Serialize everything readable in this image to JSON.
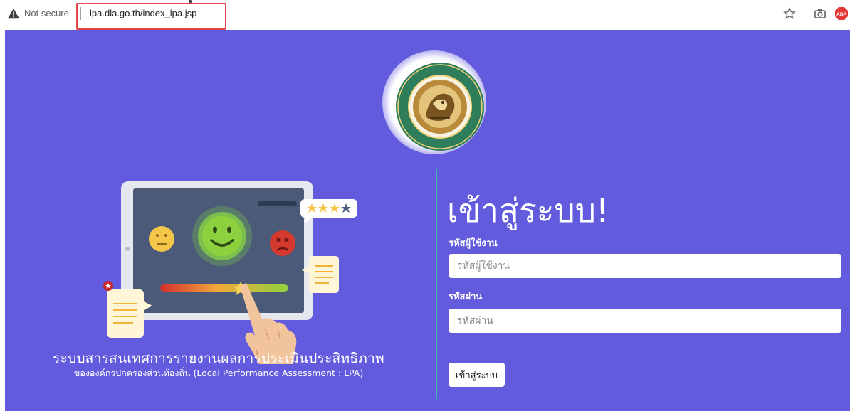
{
  "browser": {
    "security_label": "Not secure",
    "url": "lpa.dla.go.th/index_lpa.jsp",
    "icons": [
      "warning-icon",
      "star-icon",
      "camera-icon",
      "adblock-icon"
    ],
    "adblock_label": "ABP"
  },
  "brand": {
    "logo_name": "department-of-local-administration-seal",
    "system_title": "ระบบสารสนเทศการรายงานผลการประเมินประสิทธิภาพ",
    "system_subtitle": "ขององค์กรปกครองส่วนท้องถิ่น (Local Performance Assessment : LPA)"
  },
  "login": {
    "title": "เข้าสู่ระบบ!",
    "username_label": "รหัสผู้ใช้งาน",
    "username_placeholder": "รหัสผู้ใช้งาน",
    "password_label": "รหัสผ่าน",
    "password_placeholder": "รหัสผ่าน",
    "submit_label": "เข้าสู่ระบบ"
  },
  "colors": {
    "page_background": "#625bdd",
    "divider": "#46b6b0",
    "url_highlight": "#e0454b"
  }
}
